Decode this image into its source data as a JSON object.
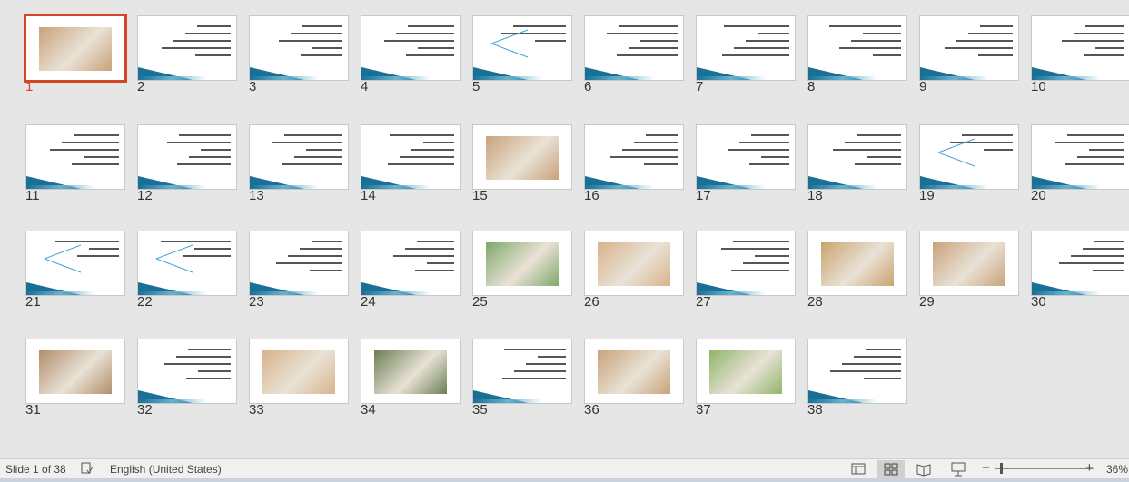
{
  "slides": [
    {
      "n": "1",
      "kind": "photo",
      "selected": true
    },
    {
      "n": "2",
      "kind": "text"
    },
    {
      "n": "3",
      "kind": "text"
    },
    {
      "n": "4",
      "kind": "text"
    },
    {
      "n": "5",
      "kind": "diagram"
    },
    {
      "n": "6",
      "kind": "text"
    },
    {
      "n": "7",
      "kind": "text"
    },
    {
      "n": "8",
      "kind": "text"
    },
    {
      "n": "9",
      "kind": "text"
    },
    {
      "n": "10",
      "kind": "text"
    },
    {
      "n": "11",
      "kind": "text"
    },
    {
      "n": "12",
      "kind": "text"
    },
    {
      "n": "13",
      "kind": "text"
    },
    {
      "n": "14",
      "kind": "text"
    },
    {
      "n": "15",
      "kind": "photo"
    },
    {
      "n": "16",
      "kind": "text"
    },
    {
      "n": "17",
      "kind": "text"
    },
    {
      "n": "18",
      "kind": "text"
    },
    {
      "n": "19",
      "kind": "diagram"
    },
    {
      "n": "20",
      "kind": "text"
    },
    {
      "n": "21",
      "kind": "diagram"
    },
    {
      "n": "22",
      "kind": "diagram"
    },
    {
      "n": "23",
      "kind": "text"
    },
    {
      "n": "24",
      "kind": "text"
    },
    {
      "n": "25",
      "kind": "photo"
    },
    {
      "n": "26",
      "kind": "photo"
    },
    {
      "n": "27",
      "kind": "text"
    },
    {
      "n": "28",
      "kind": "photo"
    },
    {
      "n": "29",
      "kind": "photo"
    },
    {
      "n": "30",
      "kind": "text"
    },
    {
      "n": "31",
      "kind": "photo"
    },
    {
      "n": "32",
      "kind": "text"
    },
    {
      "n": "33",
      "kind": "photo"
    },
    {
      "n": "34",
      "kind": "photo"
    },
    {
      "n": "35",
      "kind": "text"
    },
    {
      "n": "36",
      "kind": "photo"
    },
    {
      "n": "37",
      "kind": "photo"
    },
    {
      "n": "38",
      "kind": "text"
    }
  ],
  "status": {
    "slide_info": "Slide 1 of 38",
    "language": "English (United States)",
    "zoom": "36%",
    "minus": "−",
    "plus": "+"
  }
}
